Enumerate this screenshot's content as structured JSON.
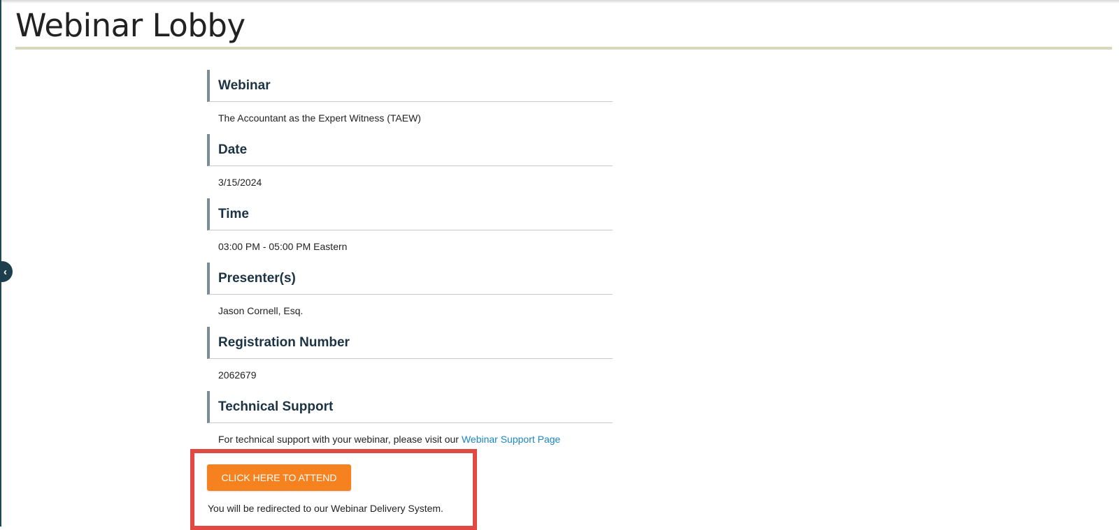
{
  "page": {
    "title": "Webinar Lobby"
  },
  "sidebar_toggle": {
    "icon": "chevron-left-icon",
    "glyph": "‹"
  },
  "sections": [
    {
      "heading": "Webinar",
      "value": "The Accountant as the Expert Witness (TAEW)"
    },
    {
      "heading": "Date",
      "value": "3/15/2024"
    },
    {
      "heading": "Time",
      "value": "03:00 PM - 05:00 PM Eastern"
    },
    {
      "heading": "Presenter(s)",
      "value": "Jason Cornell, Esq."
    },
    {
      "heading": "Registration Number",
      "value": "2062679"
    },
    {
      "heading": "Technical Support",
      "value": "For technical support with your webinar, please visit our",
      "link_text": "Webinar Support Page"
    }
  ],
  "attend": {
    "button_label": "CLICK HERE TO ATTEND",
    "note": "You will be redirected to our Webinar Delivery System."
  },
  "colors": {
    "title_rule": "#d9d7bb",
    "heading_bar": "#7b8c96",
    "heading_text": "#1c3344",
    "link": "#1a86c2",
    "button": "#f5821f",
    "highlight_border": "#e04a43"
  }
}
